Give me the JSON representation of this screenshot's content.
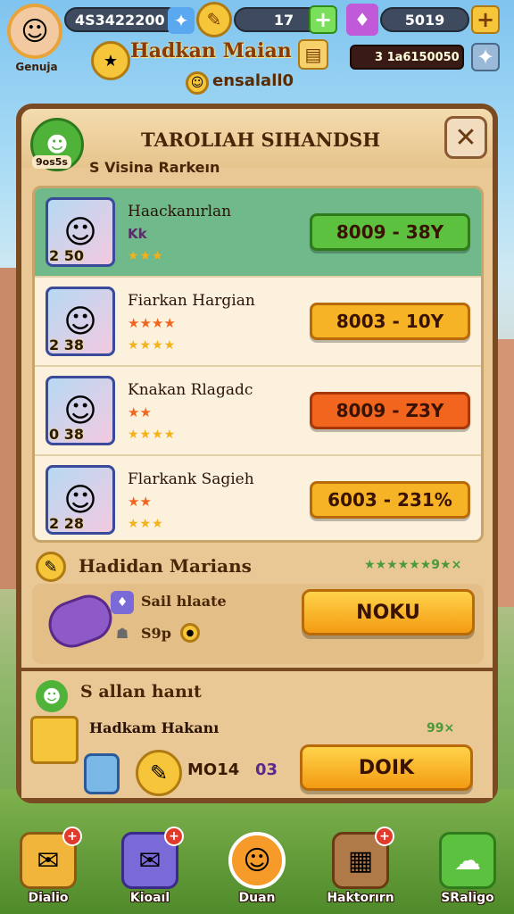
{
  "hud": {
    "player_name": "Genuja",
    "currency_1": "4S3422200",
    "currency_2": "17",
    "currency_3": "5019",
    "title": "Hadkan Maian",
    "subtitle": "ensalall0",
    "coin_value": "3 1a6150050"
  },
  "panel": {
    "title": "TAROLIAH SIHANDSH",
    "badge_label": "9os5s",
    "section_label": "S Visina Rarkeın",
    "rows": [
      {
        "name": "Haackanırlan",
        "sub": "Kk",
        "portrait_num": "2 50",
        "stars": "★★★",
        "button": "8009 - 38Y",
        "color": "#5cc13e",
        "border": "#2f7a1a",
        "highlight": true
      },
      {
        "name": "Fiarkan Hargian",
        "sub": "★★★★",
        "portrait_num": "2 38",
        "stars": "★★★★",
        "button": "8003 - 10Y",
        "color": "#f6b326",
        "border": "#b86a08",
        "highlight": false
      },
      {
        "name": "Knakan Rlagadc",
        "sub": "★★",
        "portrait_num": "0 38",
        "stars": "★★★★",
        "button": "8009 - Z3Y",
        "color": "#f2651e",
        "border": "#a8380a",
        "highlight": false
      },
      {
        "name": "Flarkank Sagieh",
        "sub": "★★",
        "portrait_num": "2 28",
        "stars": "★★★",
        "button": "6003 - 231%",
        "color": "#f6b326",
        "border": "#b86a08",
        "highlight": false
      }
    ],
    "section2_title": "Hadidan Marians",
    "section2_stars": "★★★★★★9★×",
    "section2_item1": "Sail hlaate",
    "section2_item2": "S9p",
    "section2_button": "NOKU",
    "section3_title": "S allan hanıt",
    "section3_item": "Hadkam Hakanı",
    "section3_rate": "99×",
    "section3_price": "MO14",
    "section3_suffix": "03",
    "section3_button": "DOIK"
  },
  "nav": [
    {
      "label": "Dialio",
      "icon": "ticket-icon",
      "bg": "#f0b53a",
      "badge": "+"
    },
    {
      "label": "Kioaıl",
      "icon": "ticket-blue-icon",
      "bg": "#7a6ad8",
      "badge": "+"
    },
    {
      "label": "Duan",
      "icon": "cat-icon",
      "bg": "#f69a2a",
      "badge": ""
    },
    {
      "label": "Haktorırn",
      "icon": "shop-icon",
      "bg": "#b07a48",
      "badge": "+"
    },
    {
      "label": "SRaligo",
      "icon": "cloud-icon",
      "bg": "#5cc13e",
      "badge": ""
    }
  ]
}
